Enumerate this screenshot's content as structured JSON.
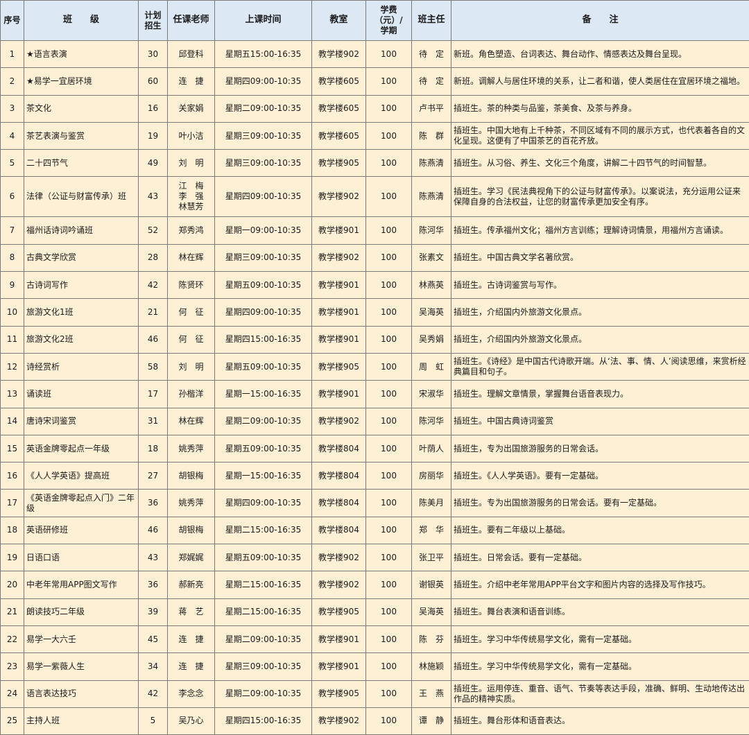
{
  "headers": {
    "no": "序号",
    "class": "班　　级",
    "planned": "计划\n招生",
    "teacher": "任课老师",
    "time": "上课时间",
    "room": "教室",
    "fee": "学费\n（元）/\n学期",
    "head_teacher": "班主任",
    "notes": "备　　注"
  },
  "rows": [
    {
      "no": "1",
      "class": "★语言表演",
      "planned": "30",
      "teacher": "邱登科",
      "time": "星期五15:00-16:35",
      "room": "教学楼902",
      "fee": "100",
      "head": "待　定",
      "note": "新班。角色塑造、台词表达、舞台动作、情感表达及舞台呈现。"
    },
    {
      "no": "2",
      "class": "★易学一宜居环境",
      "planned": "60",
      "teacher": "连　捷",
      "time": "星期四09:00-10:35",
      "room": "教学楼605",
      "fee": "100",
      "head": "待　定",
      "note": "新班。调解人与居住环境的关系，让二者和谐，使人类居住在宜居环境之福地。"
    },
    {
      "no": "3",
      "class": "茶文化",
      "planned": "16",
      "teacher": "关家娟",
      "time": "星期二09:00-10:35",
      "room": "教学楼605",
      "fee": "100",
      "head": "卢书平",
      "note": "插班生。茶的种类与品鉴，茶美食、及茶与养身。"
    },
    {
      "no": "4",
      "class": "茶艺表演与鉴赏",
      "planned": "19",
      "teacher": "叶小洁",
      "time": "星期三09:00-10:35",
      "room": "教学楼605",
      "fee": "100",
      "head": "陈　群",
      "note": "插班生。中国大地有上千种茶，不同区域有不同的展示方式，也代表着各自的文化呈现。这便有了中国茶艺的百花齐放。"
    },
    {
      "no": "5",
      "class": "二十四节气",
      "planned": "49",
      "teacher": "刘　明",
      "time": "星期三09:00-10:35",
      "room": "教学楼905",
      "fee": "100",
      "head": "陈燕清",
      "note": "插班生。从习俗、养生、文化三个角度，讲解二十四节气的时间智慧。"
    },
    {
      "no": "6",
      "class": "法律（公证与财富传承）班",
      "planned": "43",
      "teacher": "江　梅\n李　强\n林慧芳",
      "time": "星期四09:00-10:35",
      "room": "教学楼902",
      "fee": "100",
      "head": "陈燕清",
      "note": "插班生。学习《民法典视角下的公证与财富传承》。以案说法，充分运用公证来保障自身的合法权益，让您的财富传承更加安全有序。"
    },
    {
      "no": "7",
      "class": "福州话诗词吟诵班",
      "planned": "52",
      "teacher": "郑秀鸿",
      "time": "星期一09:00-10:35",
      "room": "教学楼901",
      "fee": "100",
      "head": "陈河华",
      "note": "插班生。传承福州文化；福州方言训练；理解诗词情景，用福州方言诵读。"
    },
    {
      "no": "8",
      "class": "古典文学欣赏",
      "planned": "28",
      "teacher": "林在辉",
      "time": "星期三09:00-10:35",
      "room": "教学楼902",
      "fee": "100",
      "head": "张素文",
      "note": "插班生。中国古典文学名著欣赏。"
    },
    {
      "no": "9",
      "class": "古诗词写作",
      "planned": "42",
      "teacher": "陈贤环",
      "time": "星期五09:00-10:35",
      "room": "教学楼901",
      "fee": "100",
      "head": "林燕英",
      "note": "插班生。古诗词鉴赏与写作。"
    },
    {
      "no": "10",
      "class": "旅游文化1班",
      "planned": "21",
      "teacher": "何　征",
      "time": "星期四09:00-10:35",
      "room": "教学楼901",
      "fee": "100",
      "head": "吴海英",
      "note": "插班生，介绍国内外旅游文化景点。"
    },
    {
      "no": "11",
      "class": "旅游文化2班",
      "planned": "46",
      "teacher": "何　征",
      "time": "星期四15:00-16:35",
      "room": "教学楼901",
      "fee": "100",
      "head": "吴秀娟",
      "note": "插班生，介绍国内外旅游文化景点。"
    },
    {
      "no": "12",
      "class": "诗经赏析",
      "planned": "58",
      "teacher": "刘　明",
      "time": "星期五09:00-10:35",
      "room": "教学楼905",
      "fee": "100",
      "head": "周　虹",
      "note": "插班生。《诗经》是中国古代诗歌开端。从‘法、事、情、人’阅读思维，来赏析经典篇目和句子。"
    },
    {
      "no": "13",
      "class": "诵读班",
      "planned": "17",
      "teacher": "孙楷洋",
      "time": "星期一15:00-16:35",
      "room": "教学楼901",
      "fee": "100",
      "head": "宋淑华",
      "note": "插班生。理解文章情景，掌握舞台语音表现力。"
    },
    {
      "no": "14",
      "class": "唐诗宋词鉴赏",
      "planned": "31",
      "teacher": "林在辉",
      "time": "星期二09:00-10:35",
      "room": "教学楼902",
      "fee": "100",
      "head": "陈河华",
      "note": "插班生。中国古典诗词鉴赏"
    },
    {
      "no": "15",
      "class": "英语金牌零起点一年级",
      "planned": "18",
      "teacher": "姚秀萍",
      "time": "星期五09:00-10:35",
      "room": "教学楼804",
      "fee": "100",
      "head": "叶荫人",
      "note": "插班生，专为出国旅游服务的日常会话。"
    },
    {
      "no": "16",
      "class": "《人人学英语》提高班",
      "planned": "27",
      "teacher": "胡银梅",
      "time": "星期一15:00-16:35",
      "room": "教学楼804",
      "fee": "100",
      "head": "房丽华",
      "note": "插班生。《人人学英语》。要有一定基础。"
    },
    {
      "no": "17",
      "class": "《英语金牌零起点入门》二年级",
      "planned": "36",
      "teacher": "姚秀萍",
      "time": "星期四09:00-10:35",
      "room": "教学楼804",
      "fee": "100",
      "head": "陈美月",
      "note": "插班生。专为出国旅游服务的日常会话。要有一定基础。"
    },
    {
      "no": "18",
      "class": "英语研修班",
      "planned": "46",
      "teacher": "胡银梅",
      "time": "星期二15:00-16:35",
      "room": "教学楼804",
      "fee": "100",
      "head": "郑　华",
      "note": "插班生。要有二年级以上基础。"
    },
    {
      "no": "19",
      "class": "日语口语",
      "planned": "43",
      "teacher": "郑娓娓",
      "time": "星期五09:00-10:35",
      "room": "教学楼902",
      "fee": "100",
      "head": "张卫平",
      "note": "插班生。日常会话。要有一定基础。"
    },
    {
      "no": "20",
      "class": "中老年常用APP图文写作",
      "planned": "36",
      "teacher": "郝新亮",
      "time": "星期二15:00-16:35",
      "room": "教学楼902",
      "fee": "100",
      "head": "谢银英",
      "note": "插班生。介绍中老年常用APP平台文字和图片内容的选择及写作技巧。"
    },
    {
      "no": "21",
      "class": "朗读技巧二年级",
      "planned": "39",
      "teacher": "蒋　艺",
      "time": "星期二15:00-16:35",
      "room": "教学楼905",
      "fee": "100",
      "head": "吴海英",
      "note": "插班生。舞台表演和语音训练。"
    },
    {
      "no": "22",
      "class": "易学一大六壬",
      "planned": "45",
      "teacher": "连　捷",
      "time": "星期二09:00-10:35",
      "room": "教学楼901",
      "fee": "100",
      "head": "陈　芬",
      "note": "插班生。学习中华传统易学文化，需有一定基础。"
    },
    {
      "no": "23",
      "class": "易学一紫薇人生",
      "planned": "34",
      "teacher": "连　捷",
      "time": "星期三09:00-10:35",
      "room": "教学楼901",
      "fee": "100",
      "head": "林施颖",
      "note": "插班生。学习中华传统易学文化，需有一定基础。"
    },
    {
      "no": "24",
      "class": "语言表达技巧",
      "planned": "42",
      "teacher": "李念念",
      "time": "星期二09:00-10:35",
      "room": "教学楼905",
      "fee": "100",
      "head": "王　燕",
      "note": "插班生。运用停连、重音、语气、节奏等表达手段，准确、鲜明、生动地传达出作品的精神实质。"
    },
    {
      "no": "25",
      "class": "主持人班",
      "planned": "5",
      "teacher": "吴乃心",
      "time": "星期四15:00-16:35",
      "room": "教学楼902",
      "fee": "100",
      "head": "谭　静",
      "note": "插班生。舞台形体和语音表达。"
    }
  ]
}
